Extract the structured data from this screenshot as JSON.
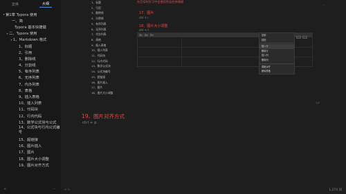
{
  "sidebar": {
    "tabs": [
      "文件",
      "大纲"
    ],
    "tree": [
      {
        "indent": 3,
        "arrow": "▾",
        "text": "第1章 Typora 使用",
        "wrap": false
      },
      {
        "indent": 12,
        "arrow": "",
        "text": "一、简",
        "wrap": false
      },
      {
        "indent": 16,
        "arrow": "",
        "text": "Typora 基本快捷键",
        "wrap": false
      },
      {
        "indent": 8,
        "arrow": "▾",
        "text": "二、Typora 使用",
        "wrap": false
      },
      {
        "indent": 14,
        "arrow": "▾",
        "text": "1、Markdown 格式",
        "wrap": false
      },
      {
        "indent": 22,
        "arrow": "",
        "text": "1、标题",
        "wrap": false
      },
      {
        "indent": 22,
        "arrow": "",
        "text": "2、引用",
        "wrap": false
      },
      {
        "indent": 22,
        "arrow": "",
        "text": "3、删除线",
        "wrap": false
      },
      {
        "indent": 22,
        "arrow": "",
        "text": "4、分割线",
        "wrap": false
      },
      {
        "indent": 22,
        "arrow": "",
        "text": "5、有序列表",
        "wrap": false
      },
      {
        "indent": 22,
        "arrow": "",
        "text": "6、无序列表",
        "wrap": false
      },
      {
        "indent": 22,
        "arrow": "",
        "text": "7、代办列表",
        "wrap": false
      },
      {
        "indent": 22,
        "arrow": "",
        "text": "8、表格",
        "wrap": false
      },
      {
        "indent": 22,
        "arrow": "",
        "text": "9、插入表格",
        "wrap": false
      },
      {
        "indent": 22,
        "arrow": "",
        "text": "10、插入列表",
        "wrap": false
      },
      {
        "indent": 22,
        "arrow": "",
        "text": "11、代码块",
        "wrap": false
      },
      {
        "indent": 22,
        "arrow": "",
        "text": "12、行内代码",
        "wrap": false
      },
      {
        "indent": 22,
        "arrow": "",
        "text": "13、数学公式块与公式",
        "wrap": false
      },
      {
        "indent": 22,
        "arrow": "",
        "text": "14、公式块与行内公式编号",
        "wrap": true
      },
      {
        "indent": 22,
        "arrow": "",
        "text": "15、超链接",
        "wrap": false
      },
      {
        "indent": 22,
        "arrow": "",
        "text": "16、图片插入",
        "wrap": false
      },
      {
        "indent": 22,
        "arrow": "",
        "text": "17、图片",
        "wrap": false
      },
      {
        "indent": 22,
        "arrow": "",
        "text": "18、图片大小调整",
        "wrap": false
      },
      {
        "indent": 22,
        "arrow": "",
        "text": "19、图片对齐方式",
        "wrap": false
      }
    ],
    "bottom_icons": [
      "+",
      "⋯"
    ]
  },
  "editor": {
    "list_items": [
      "1、标题",
      "2、引用",
      "3、删除线",
      "4、分割线",
      "5、有序列表",
      "6、无序列表",
      "7、代办列表",
      "8、表格",
      "9、插入表格",
      "10、插入列表",
      "11、代码块",
      "12、行内代码",
      "13、数学公式块",
      "14、公式块编号",
      "15、超链接",
      "16、图片插入",
      "17、图片",
      "18、图片大小调整"
    ],
    "top_note": "在后续的学习中会使用到这些快捷键",
    "section_17_title": "17、图片",
    "section_17_code": "ctrl + i",
    "section_18_title": "18、图片大小调整",
    "section_18_code": "ctrl + t",
    "section_19_title": "19、图片对齐方式",
    "section_19_code": "ctrl + p",
    "table_head": [
      "列1",
      "列2",
      "列3"
    ],
    "context_menu": [
      {
        "label": "复制",
        "sel": false
      },
      {
        "label": "粘贴",
        "sel": false
      },
      {
        "label": "插入行",
        "sel": true
      },
      {
        "label": "删除行",
        "sel": false
      },
      {
        "label": "插入列",
        "sel": false
      },
      {
        "label": "删除列",
        "sel": false
      },
      {
        "label": "表格对齐",
        "sel": false
      },
      {
        "label": "删除表格",
        "sel": false
      }
    ],
    "pager": "1/2",
    "corner": "⋯",
    "status_left": "< >",
    "status_right": "1,274 词"
  }
}
